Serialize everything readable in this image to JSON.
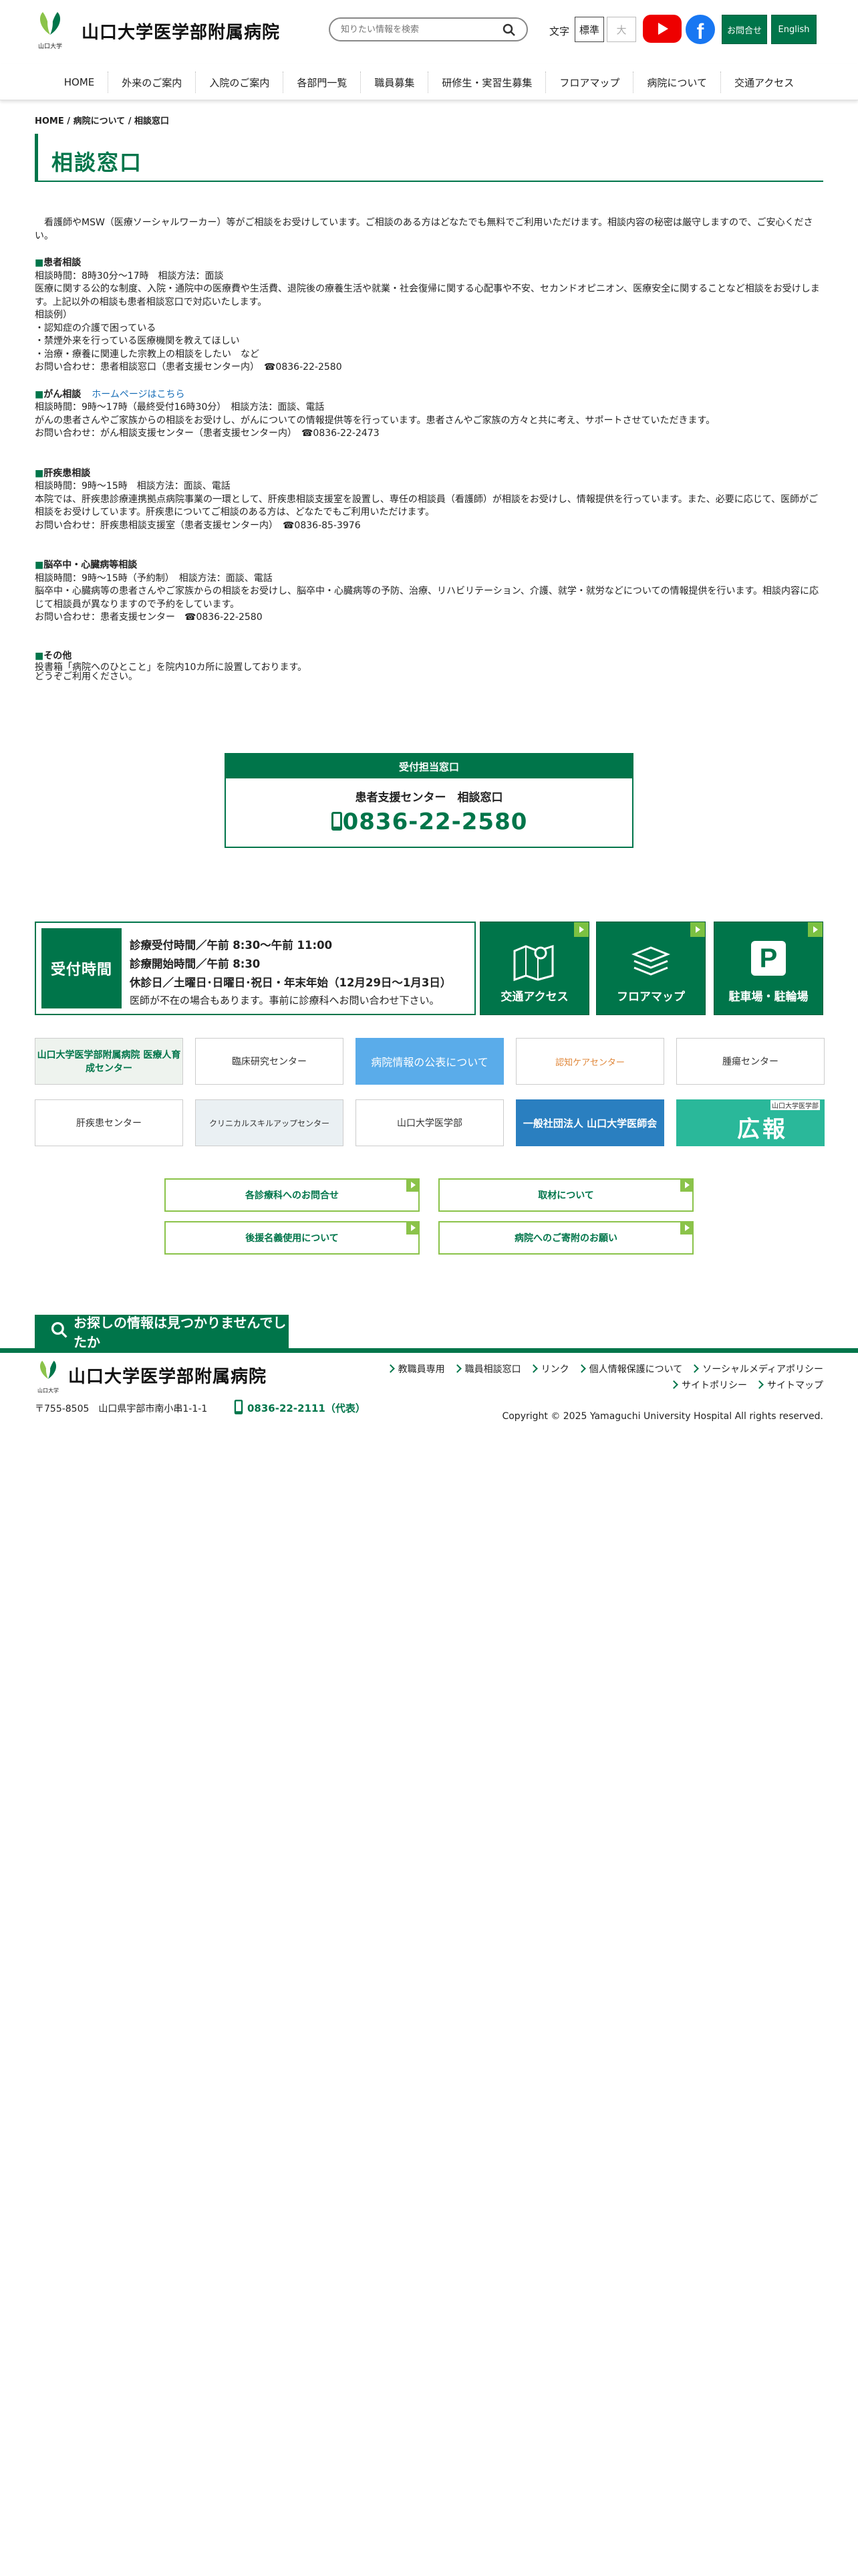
{
  "header": {
    "logo_caption": "山口大学",
    "site_title": "山口大学医学部附属病院",
    "search_placeholder": "知りたい情報を検索",
    "text_size_label": "文字",
    "text_size_standard": "標準",
    "text_size_large": "大",
    "contact_label": "お問合せ",
    "english_label": "English"
  },
  "nav": [
    "HOME",
    "外来のご案内",
    "入院のご案内",
    "各部門一覧",
    "職員募集",
    "研修生・実習生募集",
    "フロアマップ",
    "病院について",
    "交通アクセス"
  ],
  "breadcrumb": {
    "home": "HOME",
    "sep1": " / ",
    "about": "病院について",
    "sep2": " / ",
    "current": "相談窓口"
  },
  "page_title": "相談窓口",
  "intro": "看護師やMSW（医療ソーシャルワーカー）等がご相談をお受けしています。ご相談のある方はどなたでも無料でご利用いただけます。相談内容の秘密は厳守しますので、ご安心ください。",
  "sections": {
    "patient": {
      "title": "患者相談",
      "hours": "相談時間：8時30分～17時　相談方法：面談",
      "desc": "医療に関する公的な制度、入院・通院中の医療費や生活費、退院後の療養生活や就業・社会復帰に関する心配事や不安、セカンドオピニオン、医療安全に関することなど相談をお受けします。上記以外の相談も患者相談窓口で対応いたします。",
      "examples_label": "相談例）",
      "ex1": "・認知症の介護で困っている",
      "ex2": "・禁煙外来を行っている医療機関を教えてほしい",
      "ex3": "・治療・療養に関連した宗教上の相談をしたい　など",
      "contact": "お問い合わせ：患者相談窓口（患者支援センター内）　☎0836-22-2580"
    },
    "cancer": {
      "title": "がん相談",
      "link": "ホームページはこちら",
      "hours": "相談時間：9時～17時（最終受付16時30分）　相談方法：面談、電話",
      "desc": "がんの患者さんやご家族からの相談をお受けし、がんについての情報提供等を行っています。患者さんやご家族の方々と共に考え、サポートさせていただきます。",
      "contact": "お問い合わせ：がん相談支援センター（患者支援センター内）　☎0836-22-2473"
    },
    "liver": {
      "title": "肝疾患相談",
      "hours": "相談時間：9時～15時　相談方法：面談、電話",
      "desc": "本院では、肝疾患診療連携拠点病院事業の一環として、肝疾患相談支援室を設置し、専任の相談員（看護師）が相談をお受けし、情報提供を行っています。また、必要に応じて、医師がご相談をお受けしています。肝疾患についてご相談のある方は、どなたでもご利用いただけます。",
      "contact": "お問い合わせ：肝疾患相談支援室（患者支援センター内）　☎0836-85-3976"
    },
    "stroke": {
      "title": "脳卒中・心臓病等相談",
      "hours": "相談時間：9時～15時（予約制）　相談方法：面談、電話",
      "desc": "脳卒中・心臓病等の患者さんやご家族からの相談をお受けし、脳卒中・心臓病等の予防、治療、リハビリテーション、介護、就学・就労などについての情報提供を行います。相談内容に応じて相談員が異なりますので予約をしています。",
      "contact": "お問い合わせ：患者支援センター　☎0836-22-2580"
    },
    "other": {
      "title": "その他",
      "l1": "投書箱「病院へのひとこと」を院内10カ所に設置しております。",
      "l2": "どうぞご利用ください。"
    }
  },
  "phone_box": {
    "header": "受付担当窓口",
    "name": "患者支援センター　相談窓口",
    "tel": "0836-22-2580"
  },
  "reception": {
    "label": "受付時間",
    "line1": "診療受付時間／午前 8:30～午前 11:00",
    "line2": "診療開始時間／午前 8:30",
    "line3": "休診日／土曜日･日曜日･祝日・年末年始（12月29日～1月3日）",
    "line4": "医師が不在の場合もあります。事前に診療科へお問い合わせ下さい。"
  },
  "tiles": {
    "access": "交通アクセス",
    "floormap": "フロアマップ",
    "parking": "駐車場・駐輪場",
    "parking_icon_letter": "P"
  },
  "banners": {
    "b1": "山口大学医学部附属病院 医療人育成センター",
    "b2": "臨床研究センター",
    "b3": "病院情報の公表について",
    "b4": "認知ケアセンター",
    "b5": "腫瘍センター",
    "b6": "肝疾患センター",
    "b7": "クリニカルスキルアップセンター",
    "b8": "山口大学医学部",
    "b9": "一般社団法人 山口大学医師会",
    "b10_sub": "山口大学医学部",
    "b10": "広報"
  },
  "link_buttons": {
    "b1": "各診療科へのお問合せ",
    "b2": "取材について",
    "b3": "後援名義使用について",
    "b4": "病院へのご寄附のお願い"
  },
  "not_found": "お探しの情報は見つかりませんでしたか",
  "footer": {
    "logo_caption": "山口大学",
    "name": "山口大学医学部附属病院",
    "links": [
      "教職員専用",
      "職員相談窓口",
      "リンク",
      "個人情報保護について",
      "ソーシャルメディアポリシー",
      "サイトポリシー",
      "サイトマップ"
    ],
    "address": "〒755-8505　山口県宇部市南小串1-1-1",
    "tel": "0836-22-2111（代表）",
    "copyright": "Copyright © 2025 Yamaguchi University Hospital All rights reserved."
  },
  "colors": {
    "primary": "#00754a",
    "accent": "#8bc34a",
    "link": "#1a6fb8"
  }
}
